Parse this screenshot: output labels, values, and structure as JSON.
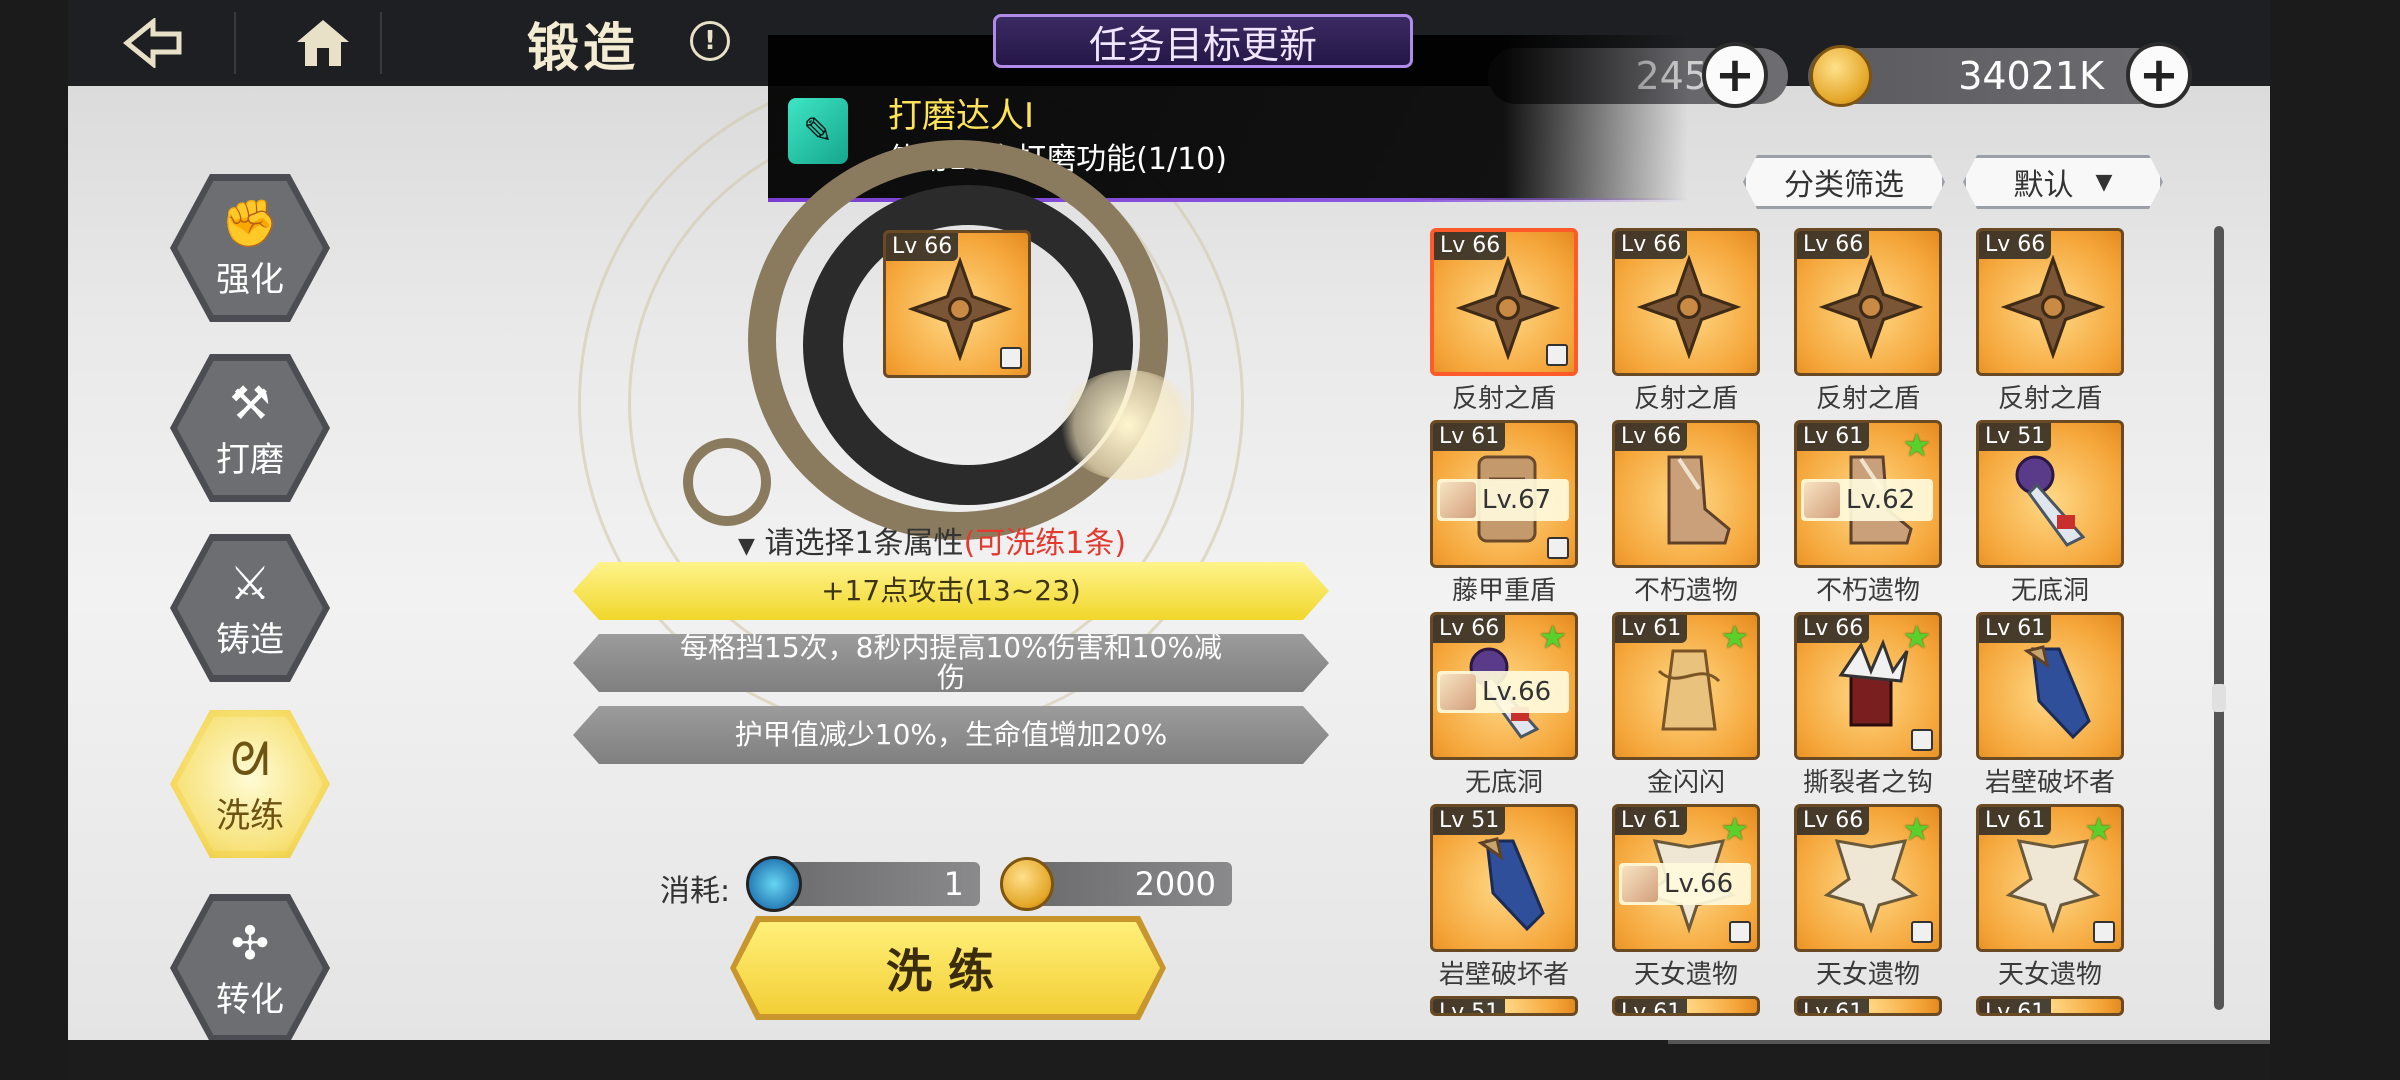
{
  "header": {
    "title": "锻造",
    "back_icon": "back-arrow-icon",
    "home_icon": "home-icon",
    "info_icon_text": "!"
  },
  "currency": {
    "gems_partial": "245",
    "gold": "34021K"
  },
  "notification": {
    "banner": "任务目标更新",
    "title": "打磨达人I",
    "desc": "使用10次打磨功能(1/10)"
  },
  "filters": {
    "category": "分类筛选",
    "sort": "默认"
  },
  "sidebar": {
    "items": [
      {
        "label": "强化",
        "glyph": "✊"
      },
      {
        "label": "打磨",
        "glyph": "⚒"
      },
      {
        "label": "铸造",
        "glyph": "⚔"
      },
      {
        "label": "洗练",
        "glyph": "ᘛ"
      },
      {
        "label": "转化",
        "glyph": "✣"
      }
    ]
  },
  "selected_item": {
    "lv": "Lv 66"
  },
  "reroll": {
    "prompt": "请选择1条属性",
    "prompt_note": "(可洗练1条)",
    "attributes": [
      "+17点攻击(13~23)",
      "每格挡15次，8秒内提高10%伤害和10%减伤",
      "护甲值减少10%，生命值增加20%"
    ],
    "cost_label": "消耗:",
    "cost_stone": "1",
    "cost_gold": "2000",
    "button": "洗练"
  },
  "inventory": [
    {
      "lv": "Lv 66",
      "name": "反射之盾",
      "art": "shield",
      "lock": true,
      "star": false,
      "equip": ""
    },
    {
      "lv": "Lv 66",
      "name": "反射之盾",
      "art": "shield",
      "lock": false,
      "star": false,
      "equip": ""
    },
    {
      "lv": "Lv 66",
      "name": "反射之盾",
      "art": "shield",
      "lock": false,
      "star": false,
      "equip": ""
    },
    {
      "lv": "Lv 66",
      "name": "反射之盾",
      "art": "shield",
      "lock": false,
      "star": false,
      "equip": ""
    },
    {
      "lv": "Lv 61",
      "name": "藤甲重盾",
      "art": "scroll",
      "lock": true,
      "star": false,
      "equip": "Lv.67"
    },
    {
      "lv": "Lv 66",
      "name": "不朽遗物",
      "art": "boot",
      "lock": false,
      "star": false,
      "equip": ""
    },
    {
      "lv": "Lv 61",
      "name": "不朽遗物",
      "art": "boot",
      "lock": false,
      "star": true,
      "equip": "Lv.62"
    },
    {
      "lv": "Lv 51",
      "name": "无底洞",
      "art": "orb",
      "lock": false,
      "star": false,
      "equip": ""
    },
    {
      "lv": "Lv 66",
      "name": "无底洞",
      "art": "orb",
      "lock": false,
      "star": true,
      "equip": "Lv.66"
    },
    {
      "lv": "Lv 61",
      "name": "金闪闪",
      "art": "vial",
      "lock": false,
      "star": true,
      "equip": ""
    },
    {
      "lv": "Lv 66",
      "name": "撕裂者之钩",
      "art": "claw",
      "lock": true,
      "star": true,
      "equip": ""
    },
    {
      "lv": "Lv 61",
      "name": "岩壁破坏者",
      "art": "blade",
      "lock": false,
      "star": false,
      "equip": ""
    },
    {
      "lv": "Lv 51",
      "name": "岩壁破坏者",
      "art": "blade",
      "lock": false,
      "star": false,
      "equip": ""
    },
    {
      "lv": "Lv 61",
      "name": "天女遗物",
      "art": "wing",
      "lock": true,
      "star": true,
      "equip": "Lv.66"
    },
    {
      "lv": "Lv 66",
      "name": "天女遗物",
      "art": "wing",
      "lock": true,
      "star": true,
      "equip": ""
    },
    {
      "lv": "Lv 61",
      "name": "天女遗物",
      "art": "wing",
      "lock": true,
      "star": true,
      "equip": ""
    }
  ],
  "inventory_partial_row": [
    "Lv 51",
    "Lv 61",
    "Lv 61",
    "Lv 61"
  ]
}
